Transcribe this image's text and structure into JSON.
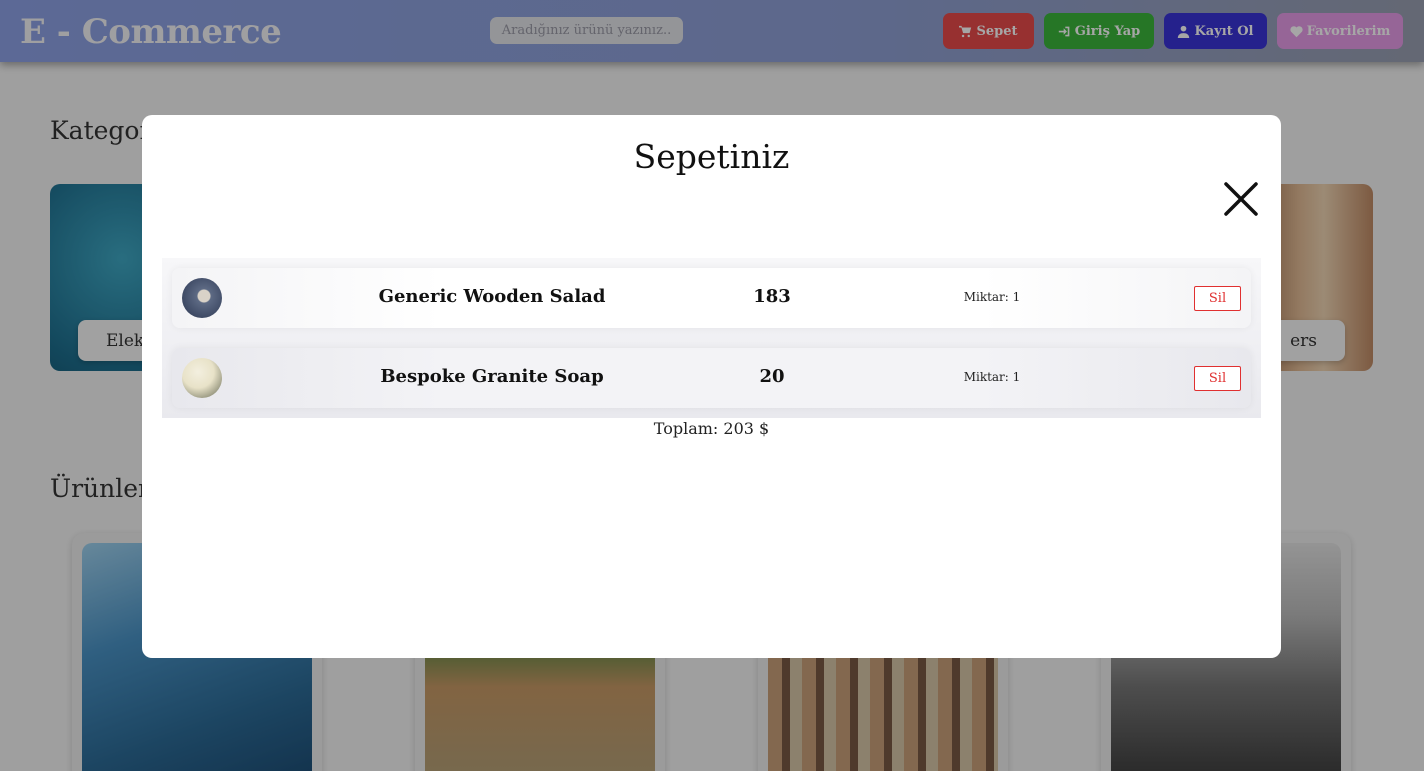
{
  "header": {
    "brand": "E - Commerce",
    "search_placeholder": "Aradığınız ürünü yazınız..",
    "buttons": {
      "cart": "Sepet",
      "login": "Giriş Yap",
      "register": "Kayıt Ol",
      "favorites": "Favorilerim"
    }
  },
  "page": {
    "categories_title": "Kategori",
    "products_title": "Ürünler",
    "category_labels": [
      "Elekt",
      "ers"
    ]
  },
  "modal": {
    "title": "Sepetiniz",
    "items": [
      {
        "name": "Generic Wooden Salad",
        "price": "183",
        "quantity": "Miktar: 1",
        "delete_label": "Sil"
      },
      {
        "name": "Bespoke Granite Soap",
        "price": "20",
        "quantity": "Miktar: 1",
        "delete_label": "Sil"
      }
    ],
    "total": "Toplam: 203 $"
  },
  "colors": {
    "cart_button": "#e84a4a",
    "login_button": "#3bb53b",
    "register_button": "#3a34d8",
    "favorites_button": "#e79ce8",
    "delete_accent": "#e03030"
  },
  "icons": {
    "cart": "cart-icon",
    "login": "sign-in-icon",
    "register": "user-icon",
    "favorites": "heart-icon",
    "close": "close-icon"
  }
}
